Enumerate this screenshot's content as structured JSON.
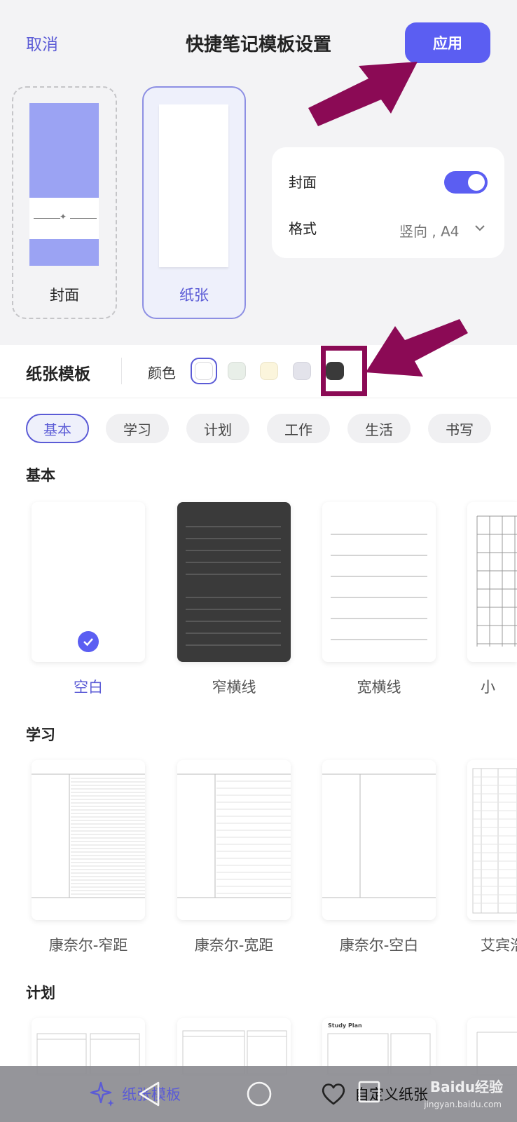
{
  "header": {
    "cancel_label": "取消",
    "title": "快捷笔记模板设置",
    "apply_label": "应用"
  },
  "cards": {
    "cover_label": "封面",
    "paper_label": "纸张"
  },
  "settings": {
    "cover_label": "封面",
    "cover_enabled": true,
    "format_label": "格式",
    "format_value": "竖向 , A4"
  },
  "template_bar": {
    "title": "纸张模板",
    "color_label": "颜色",
    "colors": [
      "#ffffff",
      "#e8efe8",
      "#fbf5dc",
      "#e3e3eb",
      "#3a3a3a"
    ],
    "selected_color_index": 0
  },
  "categories": [
    "基本",
    "学习",
    "计划",
    "工作",
    "生活",
    "书写"
  ],
  "active_category_index": 0,
  "sections": {
    "basic": {
      "title": "基本",
      "items": [
        "空白",
        "窄横线",
        "宽横线",
        "小"
      ]
    },
    "study": {
      "title": "学习",
      "items": [
        "康奈尔-窄距",
        "康奈尔-宽距",
        "康奈尔-空白",
        "艾宾浩"
      ]
    },
    "plan": {
      "title": "计划",
      "thumb_texts": [
        "Study Plan"
      ]
    }
  },
  "bottom_nav": {
    "left_label": "纸张模板",
    "right_label": "自定义纸张"
  },
  "watermark": {
    "main": "Baidu经验",
    "sub": "jingyan.baidu.com"
  },
  "colors": {
    "accent": "#5b5ef2",
    "annotation": "#8b0a55"
  }
}
